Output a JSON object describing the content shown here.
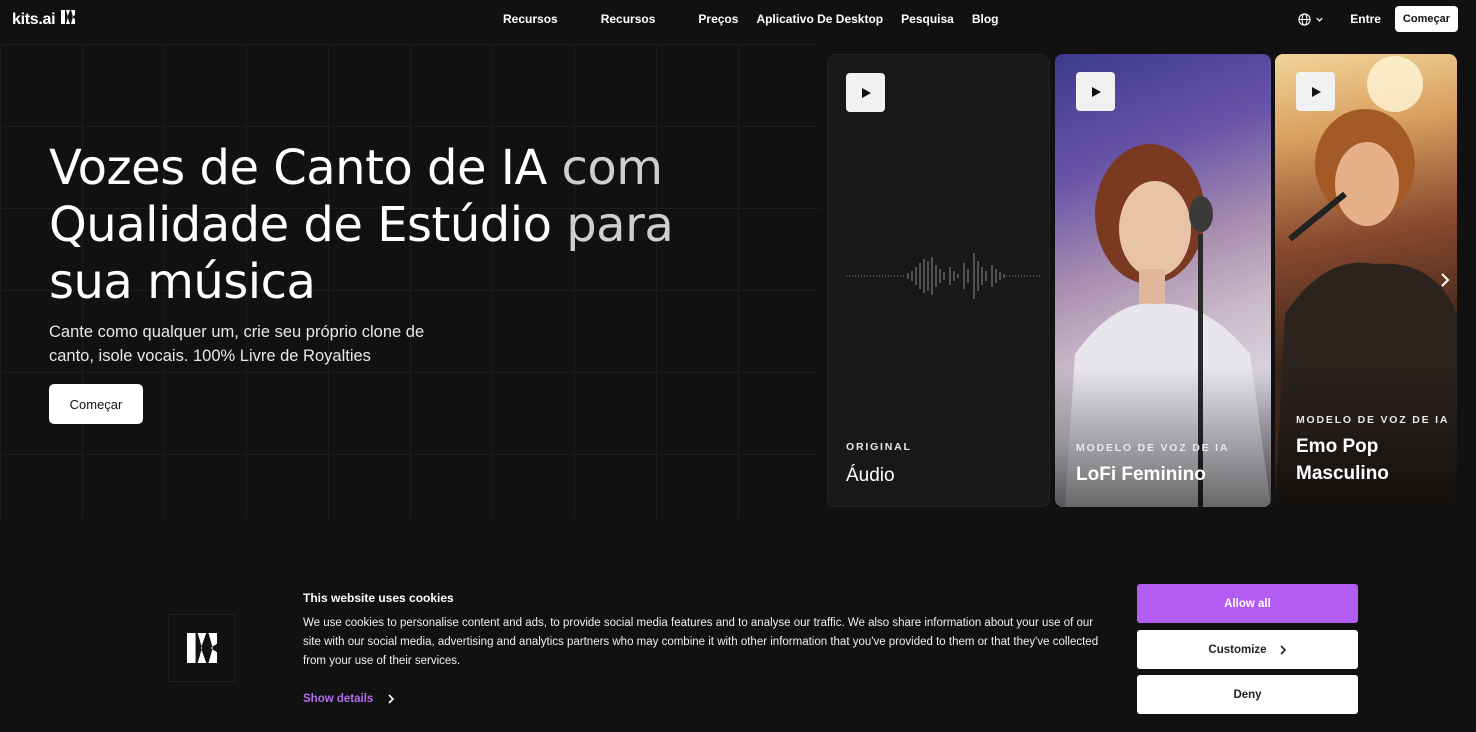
{
  "brand": {
    "name": "kits.ai"
  },
  "nav": {
    "links": [
      "Recursos",
      "Recursos",
      "Preços",
      "Aplicativo De Desktop",
      "Pesquisa",
      "Blog"
    ],
    "signin": "Entre",
    "cta": "Começar",
    "language_icon": "globe-icon"
  },
  "hero": {
    "title_line1_a": "Vozes de Canto de IA ",
    "title_line1_b": "com",
    "title_line2_a": "Qualidade de Estúdio ",
    "title_line2_b": "para",
    "title_line3": "sua música",
    "subtitle": "Cante como qualquer um, crie seu próprio clone de canto, isole vocais. 100% Livre de Royalties",
    "cta": "Começar"
  },
  "cards": [
    {
      "kicker": "ORIGINAL",
      "name": "Áudio"
    },
    {
      "kicker": "MODELO DE VOZ DE IA",
      "name": "LoFi Feminino"
    },
    {
      "kicker": "MODELO DE VOZ DE IA",
      "name": "Emo Pop Masculino"
    }
  ],
  "cookie": {
    "title": "This website uses cookies",
    "text": "We use cookies to personalise content and ads, to provide social media features and to analyse our traffic. We also share information about your use of our site with our social media, advertising and analytics partners who may combine it with other information that you've provided to them or that they've collected from your use of their services.",
    "show_details": "Show details",
    "allow_all": "Allow all",
    "customize": "Customize",
    "deny": "Deny",
    "accent": "#b35cf3"
  }
}
